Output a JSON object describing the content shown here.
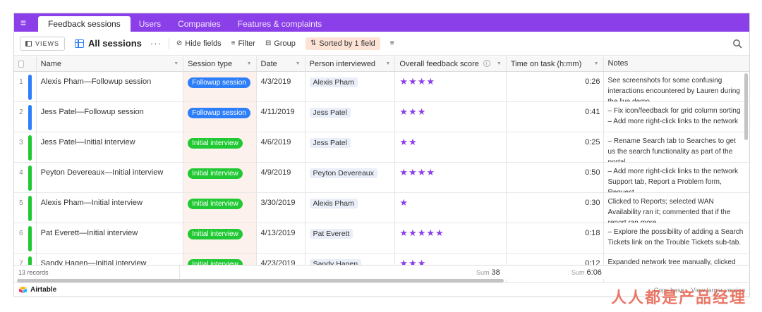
{
  "tabs": [
    {
      "label": "Feedback sessions",
      "active": true
    },
    {
      "label": "Users"
    },
    {
      "label": "Companies"
    },
    {
      "label": "Features & complaints"
    }
  ],
  "toolbar": {
    "views_label": "VIEWS",
    "view_name": "All sessions",
    "more": "···",
    "hide_fields": "Hide fields",
    "filter": "Filter",
    "group": "Group",
    "sort": "Sorted by 1 field"
  },
  "columns": {
    "name": "Name",
    "session_type": "Session type",
    "date": "Date",
    "person": "Person interviewed",
    "score": "Overall feedback score",
    "time": "Time on task (h:mm)",
    "notes": "Notes"
  },
  "rows": [
    {
      "idx": "1",
      "bar": "#2d7ff9",
      "name": "Alexis Pham—Followup session",
      "type": "Followup session",
      "type_color": "#2d7ff9",
      "date": "4/3/2019",
      "person": "Alexis Pham",
      "stars": "★★★★",
      "score": 4,
      "time": "0:26",
      "notes": "See screenshots for some confusing interactions encountered by Lauren during the live demo"
    },
    {
      "idx": "2",
      "bar": "#2d7ff9",
      "name": "Jess Patel—Followup session",
      "type": "Followup session",
      "type_color": "#2d7ff9",
      "date": "4/11/2019",
      "person": "Jess Patel",
      "stars": "★★★",
      "score": 3,
      "time": "0:41",
      "notes": "– Fix icon/feedback for grid column sorting\n– Add more right-click links to the network"
    },
    {
      "idx": "3",
      "bar": "#20c933",
      "name": "Jess Patel—Initial interview",
      "type": "Initial interview",
      "type_color": "#20c933",
      "date": "4/6/2019",
      "person": "Jess Patel",
      "stars": "★★",
      "score": 2,
      "time": "0:25",
      "notes": "– Rename Search tab to Searches to get us the search functionality as part of the portal"
    },
    {
      "idx": "4",
      "bar": "#20c933",
      "name": "Peyton Devereaux—Initial interview",
      "type": "Initial interview",
      "type_color": "#20c933",
      "date": "4/9/2019",
      "person": "Peyton Devereaux",
      "stars": "★★★★",
      "score": 4,
      "time": "0:50",
      "notes": "– Add more right-click links to the network Support tab, Report a Problem form, Request"
    },
    {
      "idx": "5",
      "bar": "#20c933",
      "name": "Alexis Pham—Initial interview",
      "type": "Initial interview",
      "type_color": "#20c933",
      "date": "3/30/2019",
      "person": "Alexis Pham",
      "stars": "★",
      "score": 1,
      "time": "0:30",
      "notes": "Clicked to Reports; selected WAN Availability ran it; commented that if the report ran more"
    },
    {
      "idx": "6",
      "bar": "#20c933",
      "name": "Pat Everett—Initial interview",
      "type": "Initial interview",
      "type_color": "#20c933",
      "date": "4/13/2019",
      "person": "Pat Everett",
      "stars": "★★★★★",
      "score": 5,
      "time": "0:18",
      "notes": "– Explore the possibility of adding a Search Tickets link on the Trouble Tickets sub-tab."
    },
    {
      "idx": "7",
      "bar": "#20c933",
      "name": "Sandy Hagen—Initial interview",
      "type": "Initial interview",
      "type_color": "#20c933",
      "date": "4/23/2019",
      "person": "Sandy Hagen",
      "stars": "★★★",
      "score": 3,
      "time": "0:12",
      "notes": "Expanded network tree manually, clicked on"
    }
  ],
  "summary": {
    "records": "13 records",
    "sum_label": "Sum",
    "score_sum": "38",
    "time_sum": "6:06"
  },
  "footer": {
    "brand": "Airtable",
    "copy_base": "Copy base",
    "view_larger": "View larger version"
  },
  "watermark": "人人都是产品经理",
  "colors": {
    "header": "#8b3fe8",
    "followup": "#2d7ff9",
    "initial": "#20c933",
    "star": "#8b3fe8"
  }
}
